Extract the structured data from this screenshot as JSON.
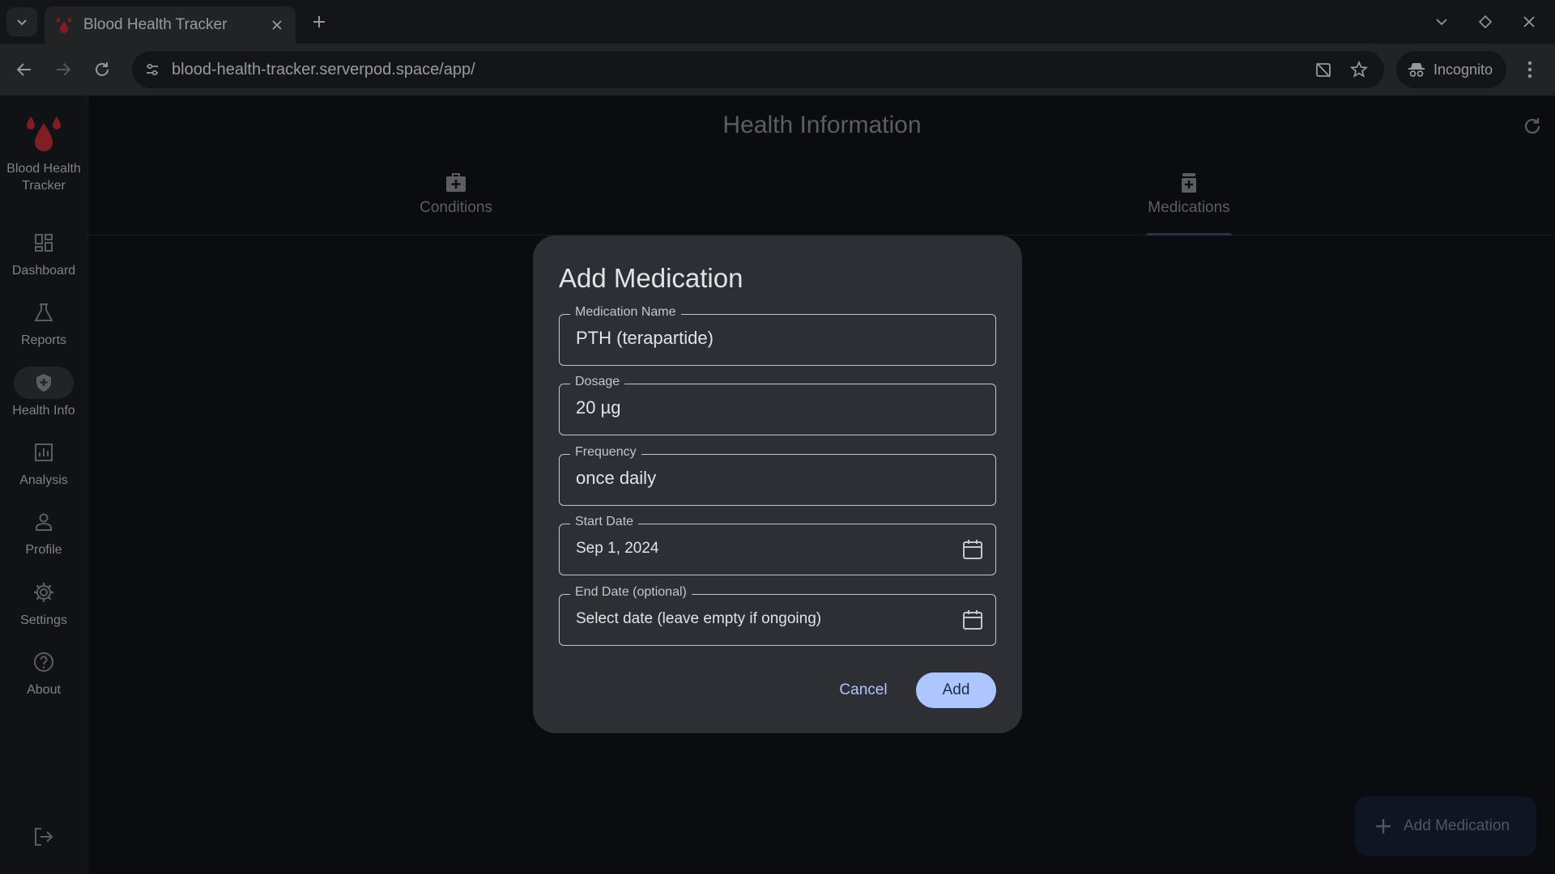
{
  "browser": {
    "tab_title": "Blood Health Tracker",
    "url": "blood-health-tracker.serverpod.space/app/",
    "incognito_label": "Incognito"
  },
  "rail": {
    "brand": "Blood Health Tracker",
    "items": [
      {
        "label": "Dashboard",
        "icon": "dashboard-icon",
        "active": false
      },
      {
        "label": "Reports",
        "icon": "flask-icon",
        "active": false
      },
      {
        "label": "Health Info",
        "icon": "shield-plus-icon",
        "active": true
      },
      {
        "label": "Analysis",
        "icon": "chart-icon",
        "active": false
      },
      {
        "label": "Profile",
        "icon": "person-icon",
        "active": false
      },
      {
        "label": "Settings",
        "icon": "gear-icon",
        "active": false
      },
      {
        "label": "About",
        "icon": "help-icon",
        "active": false
      }
    ]
  },
  "main": {
    "title": "Health Information",
    "tabs": [
      {
        "label": "Conditions",
        "icon": "medical-kit-icon",
        "selected": false
      },
      {
        "label": "Medications",
        "icon": "pill-bottle-icon",
        "selected": true
      }
    ],
    "fab_label": "Add Medication"
  },
  "dialog": {
    "title": "Add Medication",
    "fields": {
      "name": {
        "label": "Medication Name",
        "value": "PTH (terapartide)"
      },
      "dosage": {
        "label": "Dosage",
        "value": "20 µg"
      },
      "frequency": {
        "label": "Frequency",
        "value": "once daily"
      },
      "start_date": {
        "label": "Start Date",
        "value": "Sep 1, 2024"
      },
      "end_date": {
        "label": "End Date (optional)",
        "placeholder": "Select date (leave empty if ongoing)"
      }
    },
    "cancel_label": "Cancel",
    "add_label": "Add"
  },
  "colors": {
    "background": "#111318",
    "primary": "#adc6ff",
    "logo": "#c62e3a"
  }
}
